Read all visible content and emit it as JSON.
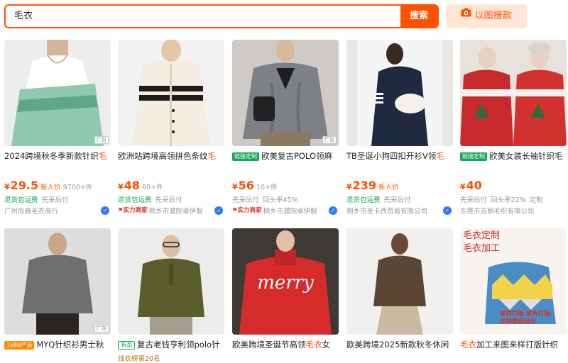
{
  "search": {
    "query": "毛衣",
    "button": "搜索",
    "image_search": "以图搜款"
  },
  "colors": {
    "accent": "#ff5000",
    "green": "#14a957",
    "blue": "#2f7df5"
  },
  "ad_label": "广告",
  "products": [
    {
      "badge": "",
      "title_pre": "2024跨境秋冬季新款针织",
      "title_hl": "毛",
      "title_post": "",
      "currency": "¥",
      "price": "29.5",
      "price_tag": "新人价",
      "sold": "9700+件",
      "services": [
        "退货包运费",
        "先采后付"
      ],
      "services_green": [
        true,
        false
      ],
      "power": "",
      "shop": "广州尚雅毛衣商行",
      "ad": true
    },
    {
      "badge": "",
      "title_pre": "欧洲站跨境高领拼色条纹",
      "title_hl": "毛",
      "title_post": "",
      "currency": "¥",
      "price": "48",
      "price_tag": "",
      "sold": "60+件",
      "services": [
        "退货包运费",
        "先采后付"
      ],
      "services_green": [
        true,
        false
      ],
      "power": "实力商家",
      "shop": "桐乡市濮院卓伊服",
      "ad": false
    },
    {
      "badge": "链接定制",
      "title_pre": "欧美复古POLO领麻",
      "title_hl": "",
      "title_post": "",
      "currency": "¥",
      "price": "56",
      "price_tag": "",
      "sold": "10+件",
      "services": [
        "先采后付",
        "回头率45%"
      ],
      "services_green": [
        false,
        false
      ],
      "power": "实力商家",
      "shop": "桐乡市濮院卓伊服",
      "ad": true
    },
    {
      "badge": "",
      "title_pre": "TB圣诞小狗四扣开衫V领",
      "title_hl": "毛",
      "title_post": "",
      "currency": "¥",
      "price": "239",
      "price_tag": "新人价",
      "sold": "",
      "services": [
        "退货包运费",
        "先采后付"
      ],
      "services_green": [
        true,
        false
      ],
      "power": "",
      "shop": "桐乡市圣卡西贸易有限公司",
      "ad": false
    },
    {
      "badge": "链接定制",
      "title_pre": "欧美女装长袖针织毛",
      "title_hl": "",
      "title_post": "",
      "currency": "¥",
      "price": "40",
      "price_tag": "",
      "sold": "",
      "services": [
        "先采后付",
        "回头率22%",
        "定制"
      ],
      "services_green": [
        false,
        false,
        false
      ],
      "power": "",
      "shop": "东莞市吉丽毛织有限公司",
      "ad": false
    },
    {
      "badge": "1688严选",
      "title_pre": "MYQ针织衫男士秋",
      "title_hl": "",
      "title_post": "",
      "rank": "",
      "ad": true
    },
    {
      "badge": "新品",
      "title_pre": "复古老钱亨利领polo针",
      "title_hl": "",
      "title_post": "",
      "rank": "线衣榜第20名",
      "ad": false
    },
    {
      "badge": "",
      "title_pre": "欧美跨境圣诞节高领",
      "title_hl": "毛衣",
      "title_post": "女",
      "rank": "",
      "ad": false
    },
    {
      "badge": "",
      "title_pre": "欧美跨境2025新款秋冬休闲",
      "title_hl": "",
      "title_post": "",
      "rank": "",
      "ad": false
    },
    {
      "badge": "",
      "title_pre": "",
      "title_hl": "毛衣",
      "title_post": "加工来图来样打版针织",
      "rank": "",
      "ad": false,
      "overlay": [
        "毛衣定制",
        "毛衣加工",
        "来样打版 来片打版",
        "支持原创设计"
      ]
    }
  ]
}
